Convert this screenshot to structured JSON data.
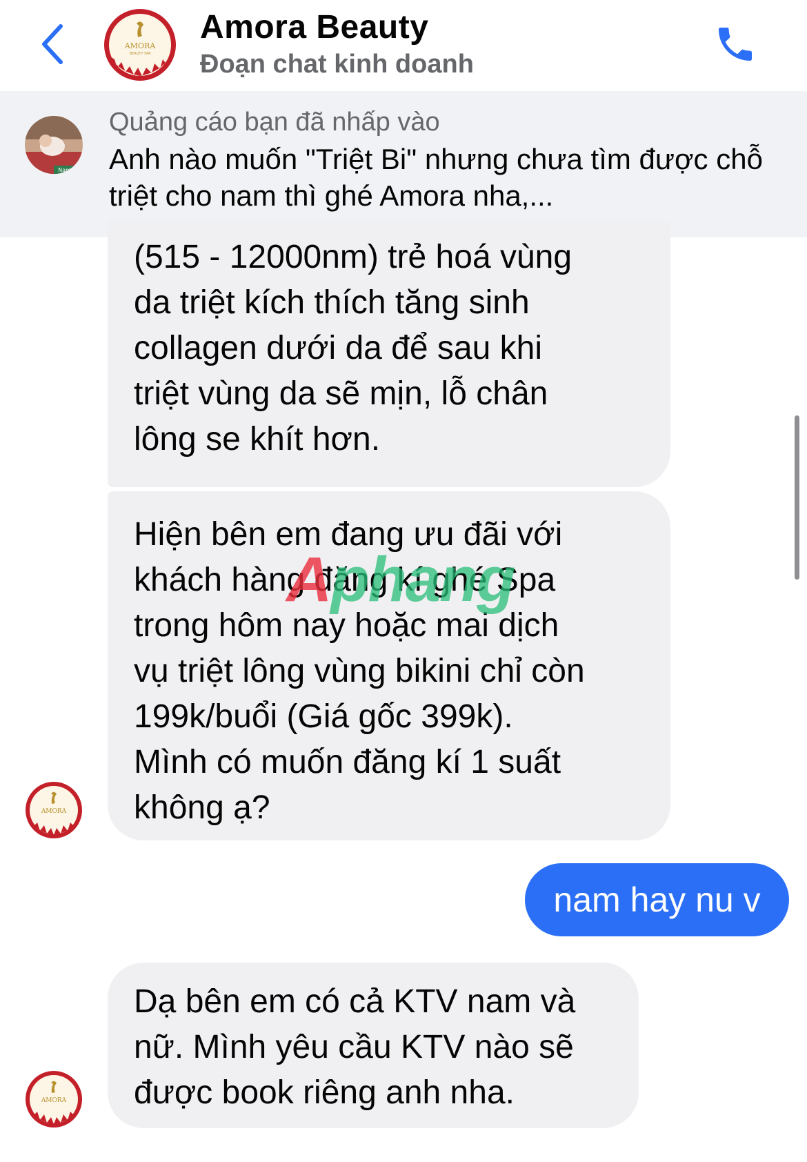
{
  "header": {
    "title": "Amora Beauty",
    "subtitle": "Đoạn chat kinh doanh",
    "logo_text": "AMORA",
    "logo_subtext": "BEAUTY SPA"
  },
  "ad": {
    "label": "Quảng cáo bạn đã nhấp vào",
    "text": "Anh nào muốn \"Triệt Bi\" nhưng chưa tìm được chỗ triệt cho nam thì ghé Amora nha,...",
    "thumb_text": "Nam 19"
  },
  "messages": [
    {
      "from": "page",
      "lines": [
        "(515 - 12000nm) trẻ hoá vùng",
        "da triệt kích thích tăng sinh",
        "collagen dưới da để sau khi",
        "triệt vùng da sẽ mịn, lỗ chân",
        "lông se khít hơn."
      ]
    },
    {
      "from": "page",
      "lines": [
        "Hiện bên em đang ưu đãi với",
        "khách hàng đăng kí ghé Spa",
        "trong hôm nay hoặc mai dịch",
        "vụ triệt lông vùng bikini chỉ còn",
        "199k/buổi (Giá gốc 399k).",
        "Mình có muốn đăng kí 1 suất",
        "không ạ?"
      ]
    },
    {
      "from": "me",
      "text": "nam hay nu v"
    },
    {
      "from": "page",
      "lines": [
        "Dạ bên em có cả KTV nam và",
        "nữ. Mình yêu cầu KTV nào sẽ",
        "được book riêng anh nha."
      ]
    }
  ],
  "watermark": {
    "first": "A",
    "rest": "phang"
  },
  "colors": {
    "accent": "#2a6ff5",
    "bubble_incoming": "#f0f0f2",
    "banner_bg": "#f0f2f5",
    "secondary_text": "#65676b",
    "logo_red": "#c4202a",
    "logo_gold": "#b8912f"
  },
  "icons": {
    "back": "chevron-left-icon",
    "call": "phone-icon"
  }
}
